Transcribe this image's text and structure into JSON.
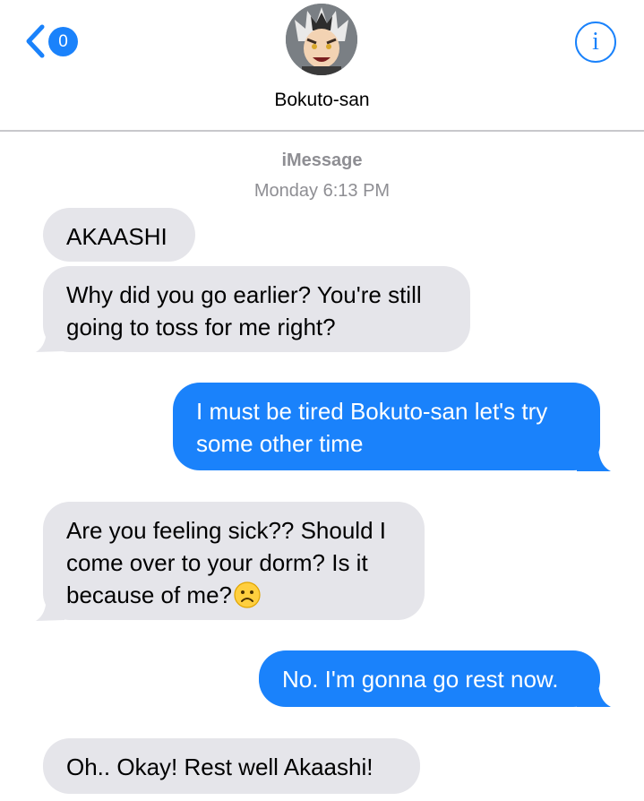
{
  "header": {
    "back_badge": "0",
    "contact_name": "Bokuto-san",
    "info_label": "i"
  },
  "meta": {
    "service": "iMessage",
    "timestamp": "Monday 6:13 PM"
  },
  "messages": [
    {
      "direction": "incoming",
      "text": "AKAASHI"
    },
    {
      "direction": "incoming",
      "text": "Why did you go earlier? You're still going to toss for me right?"
    },
    {
      "direction": "outgoing",
      "text": "I must be tired Bokuto-san let's try some other time"
    },
    {
      "direction": "incoming",
      "text": "Are you feeling sick?? Should I come over to your dorm? Is it because of me?",
      "emoji": "frowning-face"
    },
    {
      "direction": "outgoing",
      "text": "No. I'm gonna go rest now."
    },
    {
      "direction": "incoming",
      "text": "Oh.. Okay! Rest well Akaashi!"
    }
  ],
  "colors": {
    "accent": "#1a82fb",
    "incoming_bubble": "#e5e5ea",
    "secondary_text": "#8e8e93",
    "divider": "#c8c8cc"
  },
  "icons": {
    "back": "chevron-left-icon",
    "info": "info-circle-icon"
  }
}
